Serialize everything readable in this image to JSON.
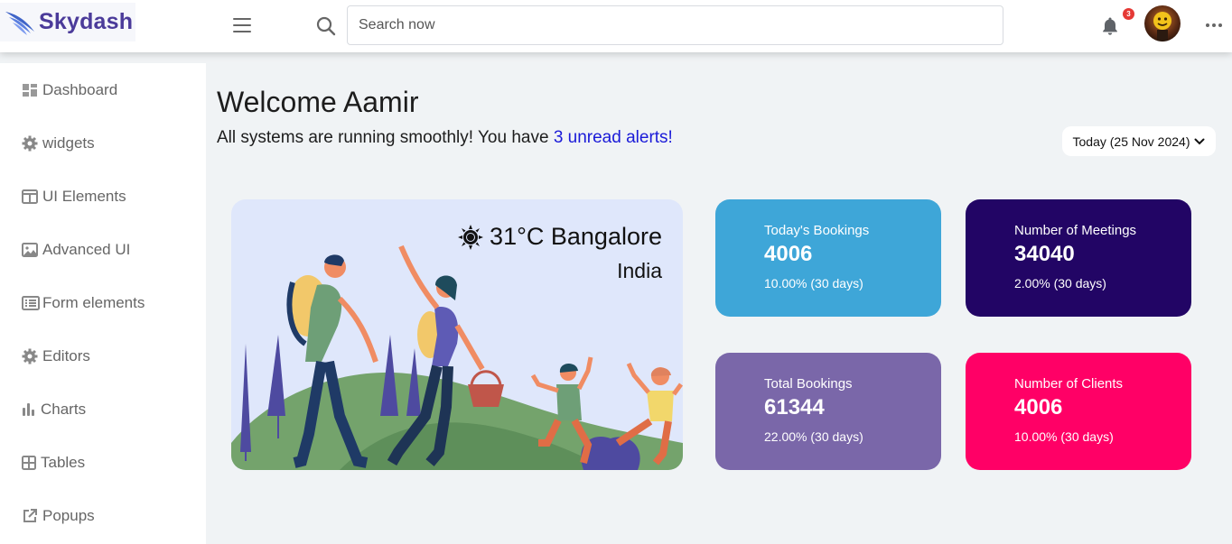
{
  "header": {
    "logo_text": "Skydash",
    "search_placeholder": "Search now",
    "notification_count": "3"
  },
  "sidebar": {
    "items": [
      {
        "label": "Dashboard",
        "icon": "dashboard-icon"
      },
      {
        "label": "widgets",
        "icon": "gear-icon"
      },
      {
        "label": "UI Elements",
        "icon": "columns-icon"
      },
      {
        "label": "Advanced UI",
        "icon": "image-icon"
      },
      {
        "label": "Form elements",
        "icon": "list-icon"
      },
      {
        "label": "Editors",
        "icon": "gear-icon"
      },
      {
        "label": "Charts",
        "icon": "bar-chart-icon"
      },
      {
        "label": "Tables",
        "icon": "table-icon"
      },
      {
        "label": "Popups",
        "icon": "external-link-icon"
      }
    ]
  },
  "main": {
    "welcome": "Welcome Aamir",
    "subtitle_prefix": "All systems are running smoothly! You have ",
    "subtitle_alerts": "3 unread alerts!",
    "date_filter": "Today (25 Nov 2024)",
    "weather": {
      "temperature": "31°C",
      "city": "Bangalore",
      "country": "India",
      "icon": "sun-icon"
    },
    "stats": [
      {
        "label": "Today's Bookings",
        "value": "4006",
        "change": "10.00% (30 days)",
        "color": "#3ea6d8"
      },
      {
        "label": "Number of Meetings",
        "value": "34040",
        "change": "2.00% (30 days)",
        "color": "#220565"
      },
      {
        "label": "Total Bookings",
        "value": "61344",
        "change": "22.00% (30 days)",
        "color": "#7a67a9"
      },
      {
        "label": "Number of Clients",
        "value": "4006",
        "change": "10.00% (30 days)",
        "color": "#ff0066"
      }
    ]
  }
}
